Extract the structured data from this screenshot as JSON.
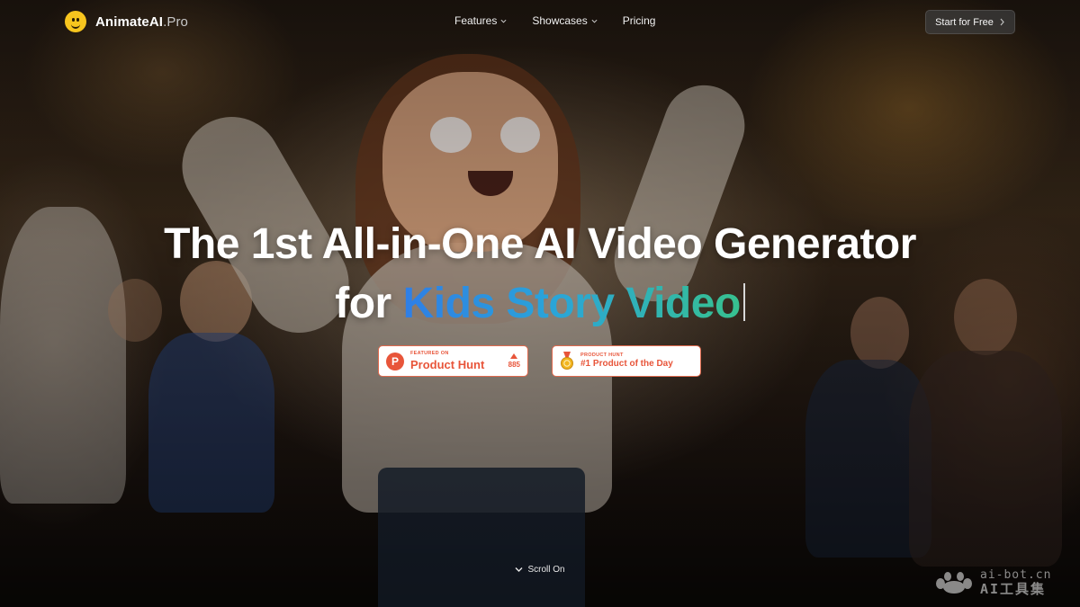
{
  "nav": {
    "logo_main": "AnimateAI",
    "logo_suffix": ".Pro",
    "links": [
      {
        "label": "Features",
        "has_dropdown": true
      },
      {
        "label": "Showcases",
        "has_dropdown": true
      },
      {
        "label": "Pricing",
        "has_dropdown": false
      }
    ],
    "cta_label": "Start for Free"
  },
  "hero": {
    "headline": "The 1st All-in-One AI Video Generator",
    "sub_prefix": "for",
    "sub_highlight": "Kids Story Video",
    "gradient_colors": [
      "#2f7ee6",
      "#2aa5d8",
      "#37c18f"
    ]
  },
  "badges": {
    "product_hunt": {
      "small": "FEATURED ON",
      "big": "Product Hunt",
      "letter": "P",
      "upvotes": "885"
    },
    "product_of_day": {
      "small": "PRODUCT HUNT",
      "big": "#1 Product of the Day"
    },
    "accent_color": "#e8553a"
  },
  "scroll_hint": "Scroll On",
  "watermark": {
    "top": "ai-bot.cn",
    "bottom": "AI工具集"
  }
}
